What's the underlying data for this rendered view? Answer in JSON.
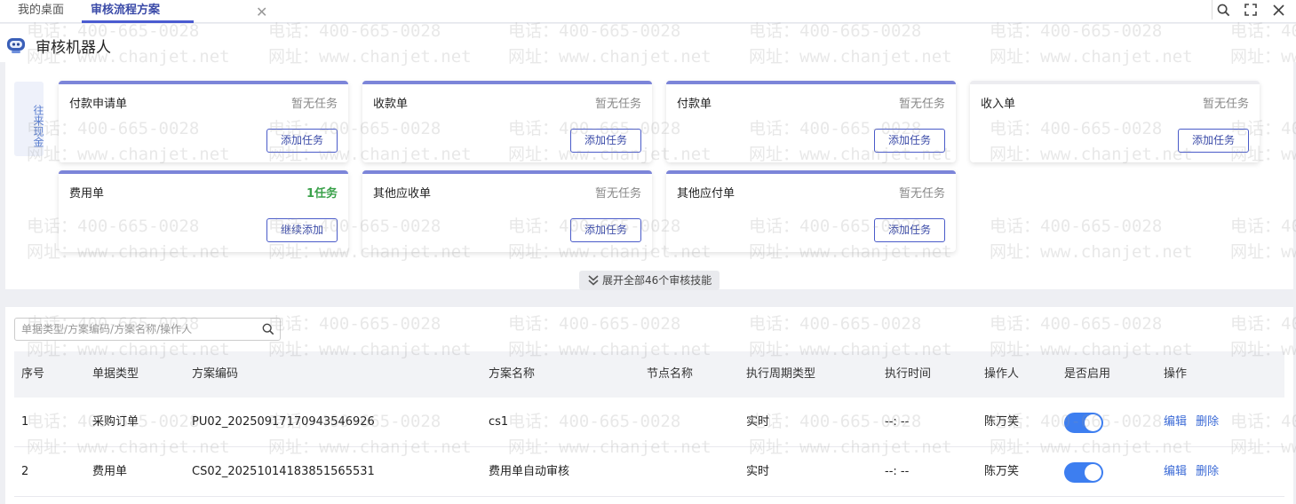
{
  "tabs": {
    "desk": "我的桌面",
    "active": "审核流程方案",
    "close_glyph": "✕"
  },
  "robot": {
    "title": "审核机器人",
    "side_label": "往来现金",
    "cards": [
      {
        "name": "付款申请单",
        "status": "暂无任务",
        "button": "添加任务",
        "active": false
      },
      {
        "name": "收款单",
        "status": "暂无任务",
        "button": "添加任务",
        "active": false
      },
      {
        "name": "付款单",
        "status": "暂无任务",
        "button": "添加任务",
        "active": false
      },
      {
        "name": "收入单",
        "status": "暂无任务",
        "button": "添加任务",
        "active": false
      },
      {
        "name": "费用单",
        "status": "1任务",
        "button": "继续添加",
        "active": true
      },
      {
        "name": "其他应收单",
        "status": "暂无任务",
        "button": "添加任务",
        "active": false
      },
      {
        "name": "其他应付单",
        "status": "暂无任务",
        "button": "添加任务",
        "active": false
      }
    ],
    "expand_label": "展开全部46个审核技能"
  },
  "search": {
    "placeholder": "单据类型/方案编码/方案名称/操作人"
  },
  "table": {
    "headers": [
      "序号",
      "单据类型",
      "方案编码",
      "方案名称",
      "节点名称",
      "执行周期类型",
      "执行时间",
      "操作人",
      "是否启用",
      "操作"
    ],
    "rows": [
      {
        "seq": "1",
        "type": "采购订单",
        "code": "PU02_20250917170943546926",
        "name": "cs1",
        "node": "",
        "cycle": "实时",
        "time": "--: --",
        "operator": "陈万笑",
        "enabled": true,
        "edit": "编辑",
        "delete": "删除"
      },
      {
        "seq": "2",
        "type": "费用单",
        "code": "CS02_20251014183851565531",
        "name": "费用单自动审核",
        "node": "",
        "cycle": "实时",
        "time": "--: --",
        "operator": "陈万笑",
        "enabled": true,
        "edit": "编辑",
        "delete": "删除"
      }
    ]
  },
  "watermark": {
    "phone": "电话：400-665-0028",
    "site": "网址：www.chanjet.net"
  },
  "colors": {
    "accent": "#4a5bd0",
    "card_top": "#7c85d9",
    "active_status": "#3aa14a",
    "toggle_on": "#3d7ef0"
  },
  "icons": [
    "search-icon",
    "fullscreen-icon",
    "close-icon",
    "robot-icon",
    "chevron-double-down-icon"
  ]
}
